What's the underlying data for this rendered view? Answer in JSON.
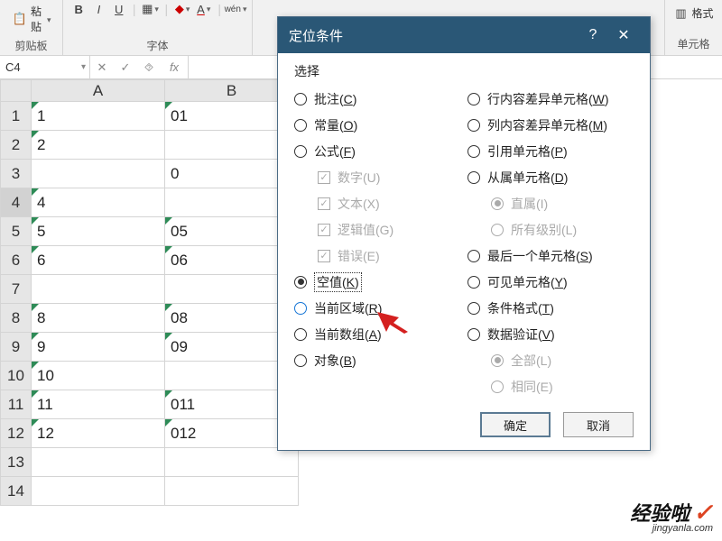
{
  "ribbon": {
    "paste_label": "粘贴",
    "clipboard_label": "剪贴板",
    "font_label": "字体",
    "wen_icon": "wén",
    "right_btn_top": "格式",
    "right_label": "单元格"
  },
  "formula_bar": {
    "name_box": "C4",
    "cancel": "✕",
    "enter": "✓",
    "btn3": "⯑",
    "fx": "fx"
  },
  "grid": {
    "cols": [
      "A",
      "B"
    ],
    "rows": [
      {
        "n": "1",
        "a": "1",
        "b": "01",
        "triA": true,
        "triB": true
      },
      {
        "n": "2",
        "a": "2",
        "b": "",
        "triA": true,
        "triB": false
      },
      {
        "n": "3",
        "a": "",
        "b": "0",
        "triA": false,
        "triB": false
      },
      {
        "n": "4",
        "a": "4",
        "b": "",
        "triA": true,
        "triB": false,
        "sel": true
      },
      {
        "n": "5",
        "a": "5",
        "b": "05",
        "triA": true,
        "triB": true
      },
      {
        "n": "6",
        "a": "6",
        "b": "06",
        "triA": true,
        "triB": true
      },
      {
        "n": "7",
        "a": "",
        "b": "",
        "triA": false,
        "triB": false
      },
      {
        "n": "8",
        "a": "8",
        "b": "08",
        "triA": true,
        "triB": true
      },
      {
        "n": "9",
        "a": "9",
        "b": "09",
        "triA": true,
        "triB": true
      },
      {
        "n": "10",
        "a": "10",
        "b": "",
        "triA": true,
        "triB": false
      },
      {
        "n": "11",
        "a": "11",
        "b": "011",
        "triA": true,
        "triB": true
      },
      {
        "n": "12",
        "a": "12",
        "b": "012",
        "triA": true,
        "triB": true
      },
      {
        "n": "13",
        "a": "",
        "b": "",
        "triA": false,
        "triB": false
      },
      {
        "n": "14",
        "a": "",
        "b": "",
        "triA": false,
        "triB": false
      }
    ]
  },
  "dialog": {
    "title": "定位条件",
    "help": "?",
    "close": "✕",
    "section": "选择",
    "left": {
      "comments": "批注(C)",
      "constants": "常量(O)",
      "formulas": "公式(F)",
      "numbers": "数字(U)",
      "text": "文本(X)",
      "logicals": "逻辑值(G)",
      "errors": "错误(E)",
      "blanks": "空值(K)",
      "current_region": "当前区域(R)",
      "current_array": "当前数组(A)",
      "objects": "对象(B)"
    },
    "right": {
      "row_diff": "行内容差异单元格(W)",
      "col_diff": "列内容差异单元格(M)",
      "precedents": "引用单元格(P)",
      "dependents": "从属单元格(D)",
      "direct": "直属(I)",
      "all_levels": "所有级别(L)",
      "last_cell": "最后一个单元格(S)",
      "visible": "可见单元格(Y)",
      "cond_fmt": "条件格式(T)",
      "data_val": "数据验证(V)",
      "all": "全部(L)",
      "same": "相同(E)"
    },
    "ok": "确定",
    "cancel": "取消"
  },
  "watermark": {
    "main": "经验啦",
    "check": "✓",
    "sub": "jingyanla.com"
  }
}
